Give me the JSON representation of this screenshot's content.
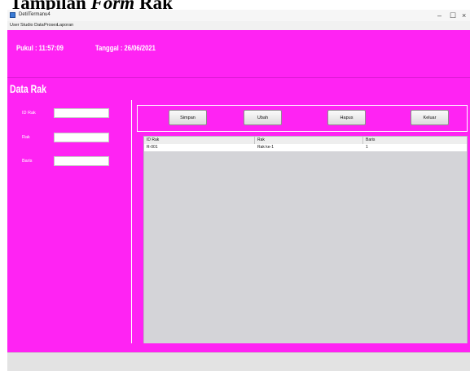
{
  "document": {
    "heading_prefix": "Tampilan",
    "heading_italic": "Form",
    "heading_suffix": "Rak"
  },
  "window": {
    "title": "DetilTermanu4",
    "controls": {
      "minimize": "–",
      "maximize": "☐",
      "close": "×"
    }
  },
  "menu": [
    "User",
    "Studio Data",
    "Proses",
    "Laporan"
  ],
  "header": {
    "time": "Pukul : 11:57:09",
    "date": "Tanggal : 26/06/2021"
  },
  "section_title": "Data Rak",
  "form": {
    "fields": [
      {
        "label": "ID Rak",
        "value": ""
      },
      {
        "label": "Rak",
        "value": ""
      },
      {
        "label": "Baris",
        "value": ""
      }
    ]
  },
  "buttons": {
    "save": "Simpan",
    "edit": "Ubah",
    "delete": "Hapus",
    "exit": "Keluar"
  },
  "table": {
    "columns": [
      "ID Rak",
      "Rak",
      "Baris"
    ],
    "rows": [
      [
        "R-001",
        "Rak ke-1",
        "1"
      ]
    ]
  },
  "colors": {
    "accent": "#ff23f3",
    "table_bg": "#d4d4d8"
  }
}
